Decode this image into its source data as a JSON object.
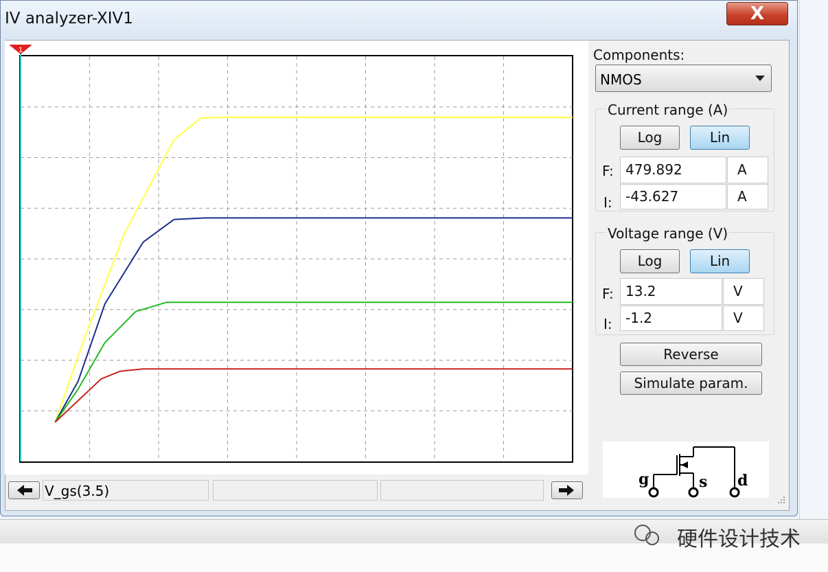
{
  "window": {
    "title": "IV analyzer-XIV1",
    "close_label": "X"
  },
  "components": {
    "label": "Components:",
    "selected": "NMOS"
  },
  "current_range": {
    "label": "Current range (A)",
    "log_label": "Log",
    "lin_label": "Lin",
    "active_scale": "Lin",
    "final_label": "F:",
    "final_value": "479.892",
    "final_unit": "A",
    "initial_label": "I:",
    "initial_value": "-43.627",
    "initial_unit": "A"
  },
  "voltage_range": {
    "label": "Voltage range (V)",
    "log_label": "Log",
    "lin_label": "Lin",
    "active_scale": "Lin",
    "final_label": "F:",
    "final_value": "13.2",
    "final_unit": "V",
    "initial_label": "I:",
    "initial_value": "-1.2",
    "initial_unit": "V"
  },
  "buttons": {
    "reverse": "Reverse",
    "simulate": "Simulate param."
  },
  "status": {
    "trace_label": "V_gs(3.5)",
    "cell2": "",
    "cell3": ""
  },
  "symbol": {
    "gate": "g",
    "source": "s",
    "drain": "d"
  },
  "watermark": {
    "text": "硬件设计技术"
  },
  "colors": {
    "yellow_curve": "#ffff66",
    "blue_curve": "#1a2f8a",
    "green_curve": "#22bb22",
    "red_curve": "#cc2222",
    "cursor": "#33cccc",
    "lin_active": "#a9d6f2"
  },
  "chart_data": {
    "type": "line",
    "xlabel": "",
    "ylabel": "",
    "xlim": [
      -1.2,
      13.2
    ],
    "ylim": [
      -43.627,
      479.892
    ],
    "grid": true,
    "cursor_x": -1.2,
    "series": [
      {
        "color": "#ffff66",
        "points": [
          [
            -0.3,
            7.0
          ],
          [
            0.5,
            120
          ],
          [
            1.5,
            250
          ],
          [
            2.8,
            372
          ],
          [
            3.5,
            400
          ],
          [
            4.0,
            401
          ],
          [
            13.2,
            401
          ]
        ]
      },
      {
        "color": "#1a2f8a",
        "points": [
          [
            -0.3,
            7.0
          ],
          [
            0.3,
            60
          ],
          [
            1.0,
            160
          ],
          [
            2.0,
            240
          ],
          [
            2.8,
            269
          ],
          [
            3.6,
            271
          ],
          [
            13.2,
            271
          ]
        ]
      },
      {
        "color": "#22bb22",
        "points": [
          [
            -0.3,
            7.0
          ],
          [
            0.3,
            50
          ],
          [
            1.0,
            110
          ],
          [
            1.8,
            150
          ],
          [
            2.6,
            162
          ],
          [
            13.2,
            162
          ]
        ]
      },
      {
        "color": "#cc2222",
        "points": [
          [
            -0.3,
            7.0
          ],
          [
            0.3,
            35
          ],
          [
            0.9,
            63
          ],
          [
            1.4,
            73
          ],
          [
            2.0,
            76
          ],
          [
            13.2,
            76
          ]
        ]
      }
    ]
  }
}
